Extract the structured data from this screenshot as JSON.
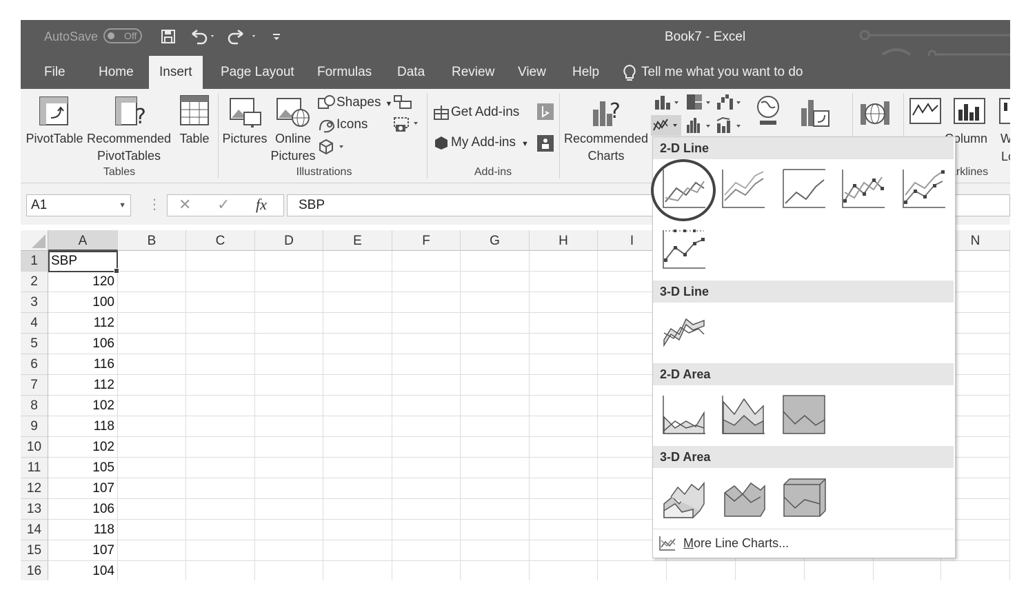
{
  "title_bar": {
    "autosave_label": "AutoSave",
    "autosave_state": "Off",
    "document_title": "Book7  -  Excel",
    "quick_access": [
      "save-icon",
      "undo-icon",
      "redo-icon",
      "customize-icon"
    ]
  },
  "tabs": [
    "File",
    "Home",
    "Insert",
    "Page Layout",
    "Formulas",
    "Data",
    "Review",
    "View",
    "Help"
  ],
  "active_tab": "Insert",
  "tell_me": "Tell me what you want to do",
  "ribbon": {
    "tables": {
      "group_label": "Tables",
      "pivottable": "PivotTable",
      "recommended_pivottables_1": "Recommended",
      "recommended_pivottables_2": "PivotTables",
      "table": "Table"
    },
    "illustrations": {
      "group_label": "Illustrations",
      "pictures": "Pictures",
      "online_pictures_1": "Online",
      "online_pictures_2": "Pictures",
      "shapes": "Shapes",
      "icons": "Icons"
    },
    "addins": {
      "group_label": "Add-ins",
      "get_addins": "Get Add-ins",
      "my_addins": "My Add-ins"
    },
    "charts": {
      "recommended_1": "Recommended",
      "recommended_2": "Charts"
    },
    "sparklines": {
      "column_label": "Column",
      "win_loss_1": "W",
      "win_loss_2": "Lo",
      "group_label": "arklines"
    }
  },
  "formula_bar": {
    "name_box": "A1",
    "cancel": "✕",
    "enter": "✓",
    "fx": "fx",
    "content": "SBP"
  },
  "grid": {
    "columns": [
      "A",
      "B",
      "C",
      "D",
      "E",
      "F",
      "G",
      "H",
      "I"
    ],
    "far_column": "N",
    "rows": [
      "1",
      "2",
      "3",
      "4",
      "5",
      "6",
      "7",
      "8",
      "9",
      "10",
      "11",
      "12",
      "13",
      "14",
      "15",
      "16"
    ],
    "column_a": [
      "SBP",
      "120",
      "100",
      "112",
      "106",
      "116",
      "112",
      "102",
      "118",
      "102",
      "105",
      "107",
      "106",
      "118",
      "107",
      "104"
    ]
  },
  "dropdown": {
    "sections": [
      "2-D Line",
      "3-D Line",
      "2-D Area",
      "3-D Area"
    ],
    "more_charts": "More Line Charts..."
  }
}
